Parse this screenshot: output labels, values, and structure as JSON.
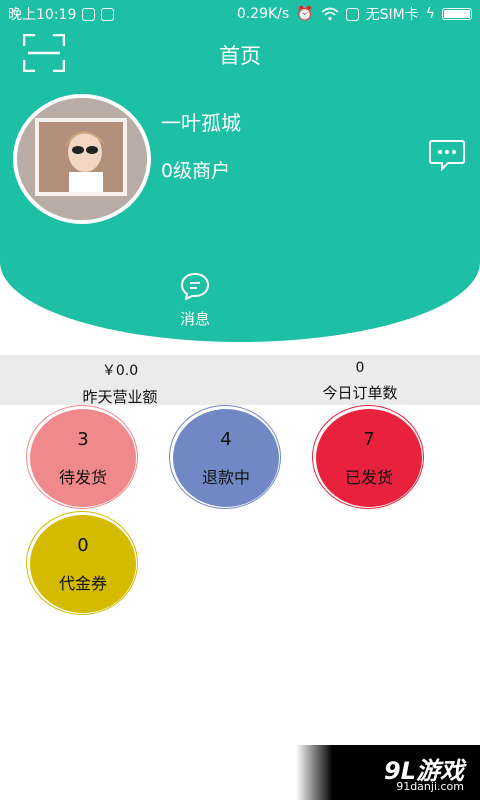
{
  "status_bar": {
    "time": "晚上10:19",
    "network_speed": "0.29K/s",
    "sim": "无SIM卡"
  },
  "header": {
    "title": "首页",
    "username": "一叶孤城",
    "merchant_level": "0级商户",
    "message_label": "消息",
    "accent_color": "#1dbfa5"
  },
  "stats": {
    "revenue_value": "￥0.0",
    "revenue_label": "昨天营业额",
    "orders_value": "0",
    "orders_label": "今日订单数"
  },
  "status_circles": [
    {
      "count": "3",
      "label": "待发货",
      "color": "#f0898c"
    },
    {
      "count": "4",
      "label": "退款中",
      "color": "#7088c4"
    },
    {
      "count": "7",
      "label": "已发货",
      "color": "#e8223c"
    },
    {
      "count": "0",
      "label": "代金券",
      "color": "#d4bb00"
    }
  ],
  "watermark": {
    "brand": "9L游戏",
    "site": "91danji.com"
  }
}
